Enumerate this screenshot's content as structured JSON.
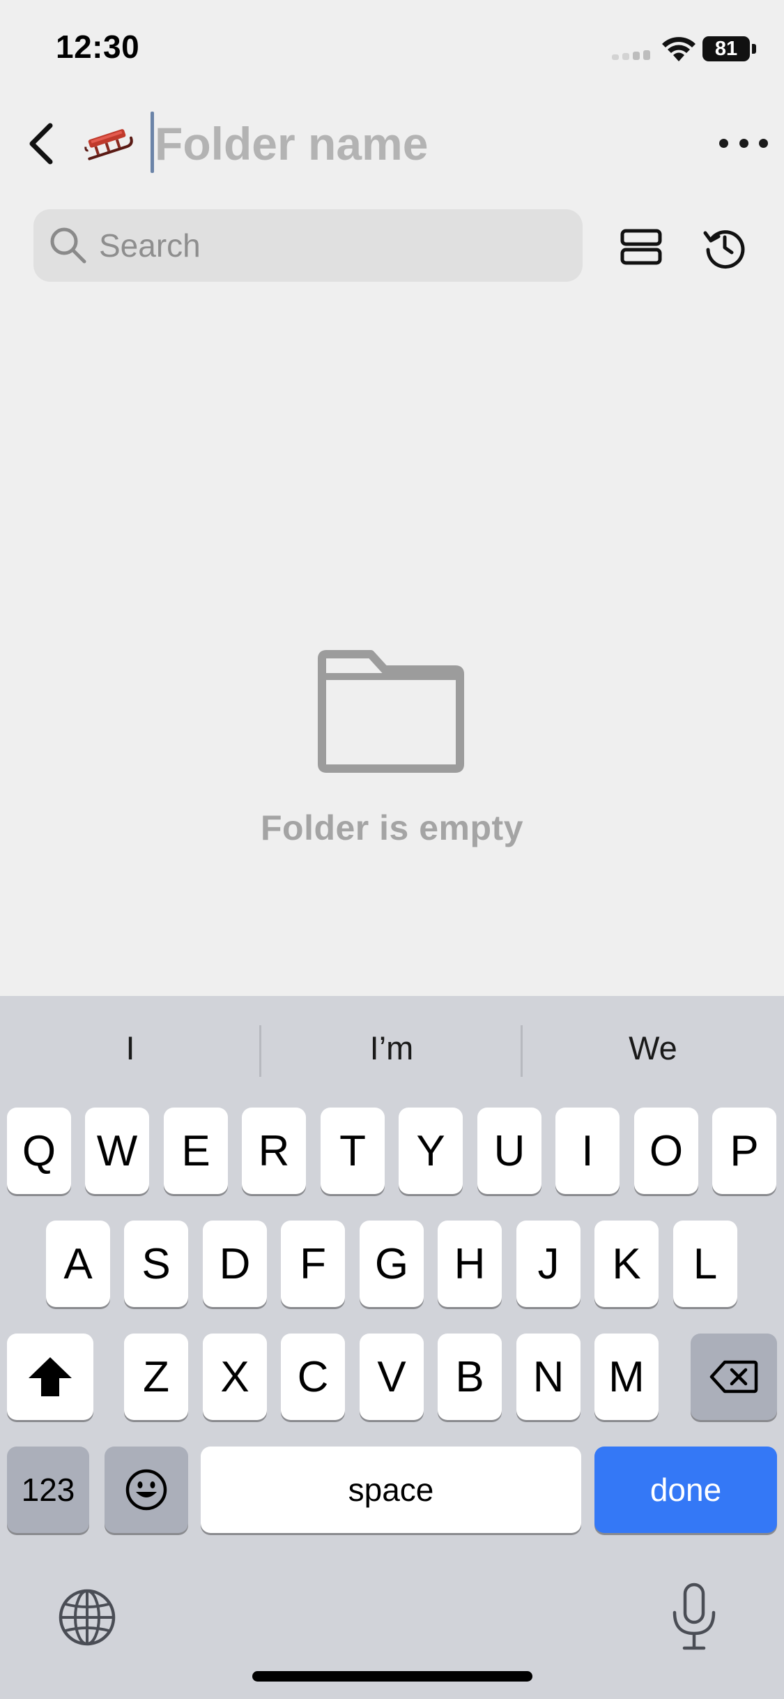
{
  "status_bar": {
    "time": "12:30",
    "battery": "81"
  },
  "header": {
    "folder_icon": "sled-emoji",
    "folder_emoji": "🛷",
    "name_placeholder": "Folder name",
    "name_value": ""
  },
  "search": {
    "placeholder": "Search"
  },
  "empty_state": {
    "icon": "folder-icon",
    "message": "Folder is empty"
  },
  "keyboard": {
    "suggestions": [
      "I",
      "I’m",
      "We"
    ],
    "row1": [
      "Q",
      "W",
      "E",
      "R",
      "T",
      "Y",
      "U",
      "I",
      "O",
      "P"
    ],
    "row2": [
      "A",
      "S",
      "D",
      "F",
      "G",
      "H",
      "J",
      "K",
      "L"
    ],
    "row3": [
      "Z",
      "X",
      "C",
      "V",
      "B",
      "N",
      "M"
    ],
    "numbers_label": "123",
    "space_label": "space",
    "done_label": "done",
    "accent_color": "#3478f6"
  }
}
